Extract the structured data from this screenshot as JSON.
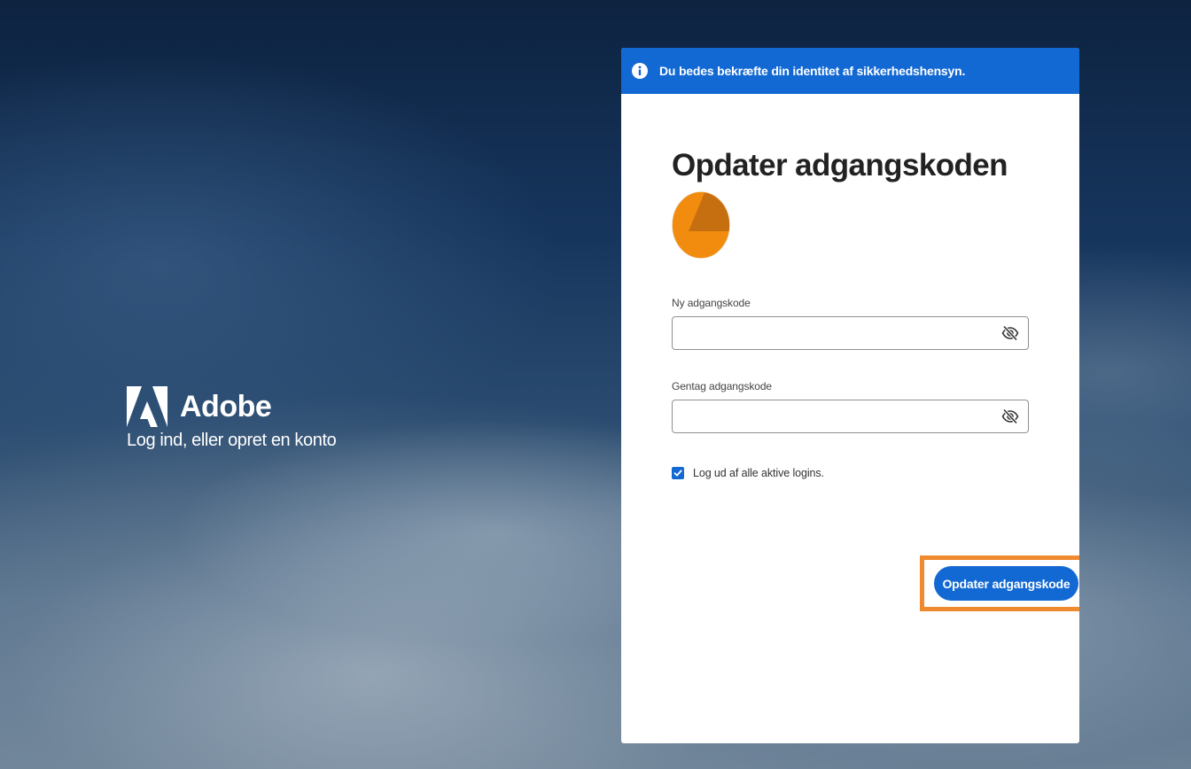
{
  "brand": {
    "name": "Adobe",
    "tagline": "Log ind, eller opret en konto",
    "logo_icon": "adobe-logo-icon"
  },
  "banner": {
    "icon": "info-icon",
    "text": "Du bedes bekræfte din identitet af sikkerhedshensyn.",
    "color": "#1269d3"
  },
  "form": {
    "title": "Opdater adgangskoden",
    "avatar_icon": "avatar-icon",
    "new_password": {
      "label": "Ny adgangskode",
      "value": "",
      "toggle_icon": "eye-slash-icon"
    },
    "repeat_password": {
      "label": "Gentag adgangskode",
      "value": "",
      "toggle_icon": "eye-slash-icon"
    },
    "logout_all": {
      "label": "Log ud af alle aktive logins.",
      "checked": true
    },
    "submit_label": "Opdater adgangskode"
  },
  "colors": {
    "accent": "#1269d3",
    "highlight_outline": "#ef8a2e",
    "avatar": "#f28c0f"
  }
}
